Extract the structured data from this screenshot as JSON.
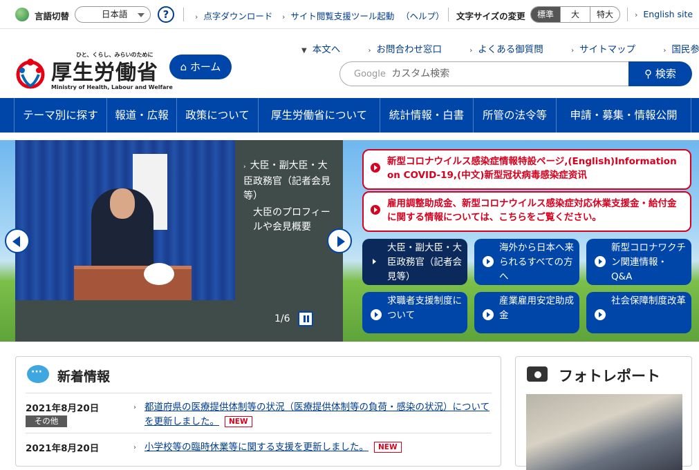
{
  "util": {
    "lang_label": "言語切替",
    "lang_value": "日本語",
    "help": "?",
    "braille": "点字ダウンロード",
    "reader_tool": "サイト閲覧支援ツール起動",
    "reader_help": "（ヘルプ）",
    "fontsize_label": "文字サイズの変更",
    "fontsizes": [
      "標準",
      "大",
      "特大"
    ],
    "english": "English site"
  },
  "header": {
    "tagline": "ひと、くらし、みらいのために",
    "title": "厚生労働省",
    "title_en": "Ministry of Health, Labour and Welfare",
    "home": "ホーム",
    "links": [
      "本文へ",
      "お問合わせ窓口",
      "よくある御質問",
      "サイトマップ",
      "国民参加の場"
    ],
    "search_brand": "Google",
    "search_placeholder": "カスタム検索",
    "search_button": "検索"
  },
  "nav": [
    "テーマ別に探す",
    "報道・広報",
    "政策について",
    "厚生労働省について",
    "統計情報・白書",
    "所管の法令等",
    "申請・募集・情報公開"
  ],
  "hero": {
    "slide_text1": "大臣・副大臣・大臣政務官（記者会見等）",
    "slide_text2": "大臣のプロフィールや会見概要",
    "counter": "1/6",
    "alerts": [
      "新型コロナウイルス感染症情報特設ページ,(English)Information on COVID-19,(中文)新型冠状病毒感染症资讯",
      "雇用調整助成金、新型コロナウイルス感染症対応休業支援金・給付金に関する情報については、こちらをご覧ください。"
    ],
    "tiles": [
      "大臣・副大臣・大臣政務官（記者会見等）",
      "海外から日本へ来られるすべての方へ",
      "新型コロナワクチン関連情報・Q&A",
      "求職者支援制度について",
      "産業雇用安定助成金",
      "社会保障制度改革"
    ]
  },
  "news": {
    "title": "新着情報",
    "new_label": "NEW",
    "items": [
      {
        "date": "2021年8月20日",
        "category": "その他",
        "text": "都道府県の医療提供体制等の状況（医療提供体制等の負荷・感染の状況）についてを更新しました。"
      },
      {
        "date": "2021年8月20日",
        "category": "",
        "text": "小学校等の臨時休業等に関する支援を更新しました。"
      }
    ]
  },
  "photo": {
    "title": "フォトレポート"
  }
}
